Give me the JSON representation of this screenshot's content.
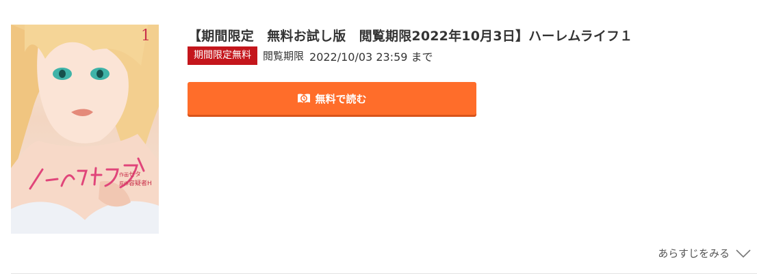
{
  "cover": {
    "alt": "ハーレムライフ 1",
    "volume_number": "1",
    "series_title_art": "ハーレムライフ",
    "credits": [
      {
        "role": "作画",
        "name": "ゼタ"
      },
      {
        "role": "原作",
        "name": "容疑者H"
      }
    ]
  },
  "product": {
    "title": "【期間限定　無料お試し版　閲覧期限2022年10月3日】ハーレムライフ１",
    "badge": "期間限定無料",
    "deadline_label": "閲覧期限",
    "deadline_value": "2022/10/03 23:59 まで"
  },
  "actions": {
    "read_free_label": "無料で読む",
    "read_free_icon": "book-icon"
  },
  "synopsis": {
    "toggle_label": "あらすじをみる",
    "toggle_icon": "chevron-down-icon"
  },
  "colors": {
    "badge_bg": "#c4161c",
    "button_bg": "#ff6d2a",
    "text": "#333333"
  }
}
